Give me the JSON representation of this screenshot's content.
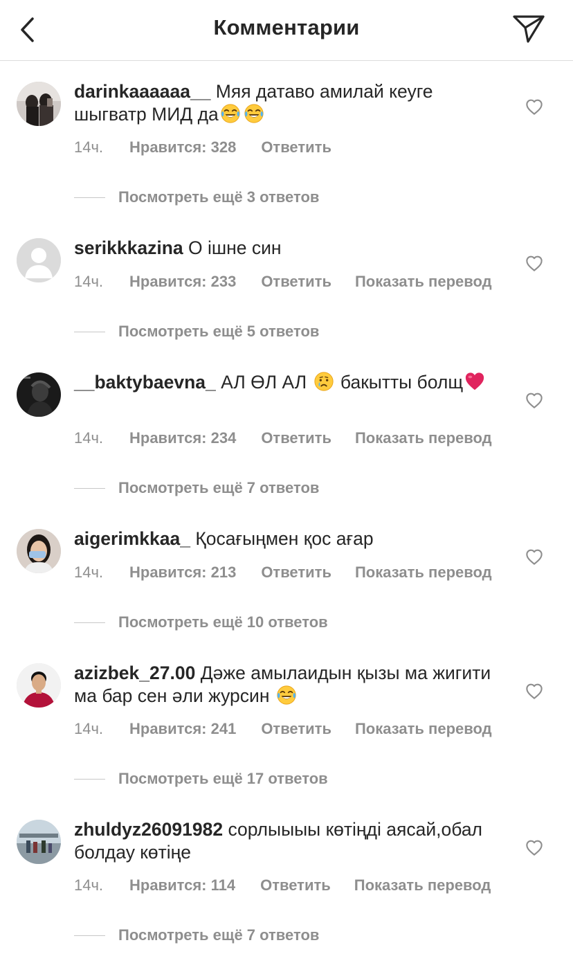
{
  "header": {
    "title": "Комментарии",
    "back_icon": "chevron-left-icon",
    "share_icon": "paper-plane-icon"
  },
  "comments": [
    {
      "username": "darinkaaaaaa__",
      "text": " Мяя датаво  амилай кеуге шыгватр МИД да",
      "emoji_after": [
        "face-with-tears-of-joy",
        "face-with-tears-of-joy"
      ],
      "time": "14ч.",
      "likes": "Нравится: 328",
      "reply": "Ответить",
      "translate": "",
      "view_more": "Посмотреть ещё 3 ответов"
    },
    {
      "username": "serikkkazina",
      "text": " О ішне син",
      "emoji_after": [],
      "time": "14ч.",
      "likes": "Нравится: 233",
      "reply": "Ответить",
      "translate": "Показать перевод",
      "view_more": "Посмотреть ещё 5 ответов"
    },
    {
      "username": "__baktybaevna_",
      "text_a": " АЛ ӨЛ АЛ ",
      "text_b": " бакытты болщ",
      "emoji_mid": "crying-face",
      "emoji_after": [
        "red-heart"
      ],
      "time": "14ч.",
      "likes": "Нравится: 234",
      "reply": "Ответить",
      "translate": "Показать перевод",
      "view_more": "Посмотреть ещё 7 ответов"
    },
    {
      "username": "aigerimkkaa_",
      "text": " Қосағыңмен қос ағар",
      "emoji_after": [],
      "time": "14ч.",
      "likes": "Нравится: 213",
      "reply": "Ответить",
      "translate": "Показать перевод",
      "view_more": "Посмотреть ещё 10 ответов"
    },
    {
      "username": "azizbek_27.00",
      "text": " Дәже амылаидын қызы ма жигити ма бар сен әли журсин ",
      "emoji_after": [
        "face-with-tears-of-joy"
      ],
      "time": "14ч.",
      "likes": "Нравится: 241",
      "reply": "Ответить",
      "translate": "Показать перевод",
      "view_more": "Посмотреть ещё 17 ответов"
    },
    {
      "username": "zhuldyz26091982",
      "text": " сорлыыыы  көтіңді аясай,обал болдау көтіңе",
      "emoji_after": [],
      "time": "14ч.",
      "likes": "Нравится: 114",
      "reply": "Ответить",
      "translate": "Показать перевод",
      "view_more": "Посмотреть ещё 7 ответов"
    }
  ],
  "colors": {
    "text": "#262626",
    "secondary": "#8e8e8e",
    "divider": "#dbdbdb",
    "heart_emoji": "#e0245e"
  }
}
